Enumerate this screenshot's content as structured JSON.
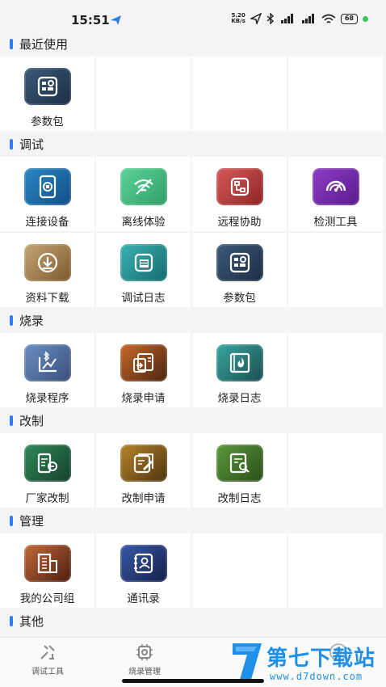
{
  "status_bar": {
    "time": "15:51",
    "speed": "5.20",
    "speed_unit": "KB/s",
    "battery": "68"
  },
  "sections": [
    {
      "title": "最近使用",
      "items": [
        {
          "label": "参数包",
          "icon": "parameters-icon",
          "color_from": "#3c5a7a",
          "color_to": "#1c2e44"
        }
      ]
    },
    {
      "title": "调试",
      "items": [
        {
          "label": "连接设备",
          "icon": "tablet-icon",
          "color_from": "#2a88c6",
          "color_to": "#134e86"
        },
        {
          "label": "离线体验",
          "icon": "wifi-off-icon",
          "color_from": "#5ed39a",
          "color_to": "#2f9f66"
        },
        {
          "label": "远程协助",
          "icon": "remote-icon",
          "color_from": "#d65a5a",
          "color_to": "#8f2525"
        },
        {
          "label": "检测工具",
          "icon": "gauge-icon",
          "color_from": "#8e3cc6",
          "color_to": "#5a1c8c"
        },
        {
          "label": "资料下载",
          "icon": "download-icon",
          "color_from": "#c4a574",
          "color_to": "#7d5a2c"
        },
        {
          "label": "调试日志",
          "icon": "log-icon",
          "color_from": "#3bb3b3",
          "color_to": "#156b70"
        },
        {
          "label": "参数包",
          "icon": "parameters-icon",
          "color_from": "#3c5a7a",
          "color_to": "#1c2e44"
        }
      ]
    },
    {
      "title": "烧录",
      "items": [
        {
          "label": "烧录程序",
          "icon": "bluetooth-chart-icon",
          "color_from": "#6a8fc4",
          "color_to": "#3a4f78"
        },
        {
          "label": "烧录申请",
          "icon": "flash-apply-icon",
          "color_from": "#c86a2a",
          "color_to": "#4a2410"
        },
        {
          "label": "烧录日志",
          "icon": "fire-book-icon",
          "color_from": "#3aa6a0",
          "color_to": "#1a4e52"
        }
      ]
    },
    {
      "title": "改制",
      "items": [
        {
          "label": "厂家改制",
          "icon": "factory-doc-icon",
          "color_from": "#2f8a5a",
          "color_to": "#16402c"
        },
        {
          "label": "改制申请",
          "icon": "edit-doc-icon",
          "color_from": "#b8862a",
          "color_to": "#4e3410"
        },
        {
          "label": "改制日志",
          "icon": "search-doc-icon",
          "color_from": "#5a9a3a",
          "color_to": "#2c4e1a"
        }
      ]
    },
    {
      "title": "管理",
      "items": [
        {
          "label": "我的公司组",
          "icon": "building-icon",
          "color_from": "#c46a3a",
          "color_to": "#4a1e10"
        },
        {
          "label": "通讯录",
          "icon": "contacts-icon",
          "color_from": "#3a5aa8",
          "color_to": "#14204a"
        }
      ]
    },
    {
      "title": "其他",
      "items": []
    }
  ],
  "bottom_nav": [
    {
      "label": "调试工具",
      "icon": "debug-tools-icon"
    },
    {
      "label": "烧录管理",
      "icon": "flash-manage-icon"
    },
    {
      "label": "",
      "icon": "profile-icon"
    }
  ],
  "watermark": {
    "text": "第七下载站",
    "url": "www.d7down.com"
  }
}
